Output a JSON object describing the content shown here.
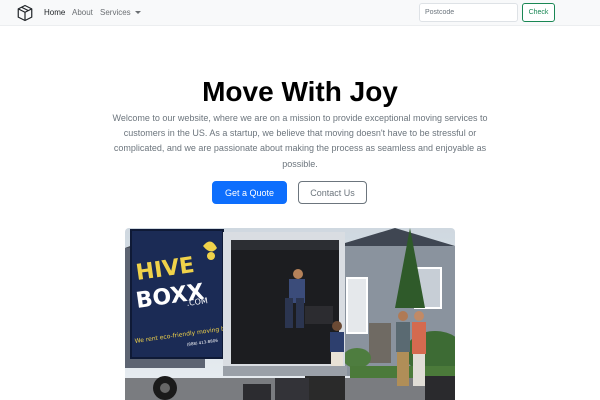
{
  "nav": {
    "links": [
      "Home",
      "About",
      "Services"
    ],
    "postcode_placeholder": "Postcode",
    "check_label": "Check"
  },
  "hero": {
    "title": "Move With Joy",
    "description": "Welcome to our website, where we are on a mission to provide exceptional moving services to customers in the US. As a startup, we believe that moving doesn't have to be stressful or complicated, and we are passionate about making the process as seamless and enjoyable as possible.",
    "primary_button": "Get a Quote",
    "secondary_button": "Contact Us"
  },
  "image": {
    "truck_brand_line1": "HIVE",
    "truck_brand_line2": "BOXX",
    "truck_brand_suffix": ".COM",
    "truck_tagline": "We rent eco-friendly moving boxes",
    "truck_phone": "(888) 413-8806"
  },
  "colors": {
    "primary": "#0d6efd",
    "success": "#198754",
    "secondary": "#6c757d",
    "truck_navy": "#1b2b55",
    "truck_yellow": "#f0d24a"
  }
}
